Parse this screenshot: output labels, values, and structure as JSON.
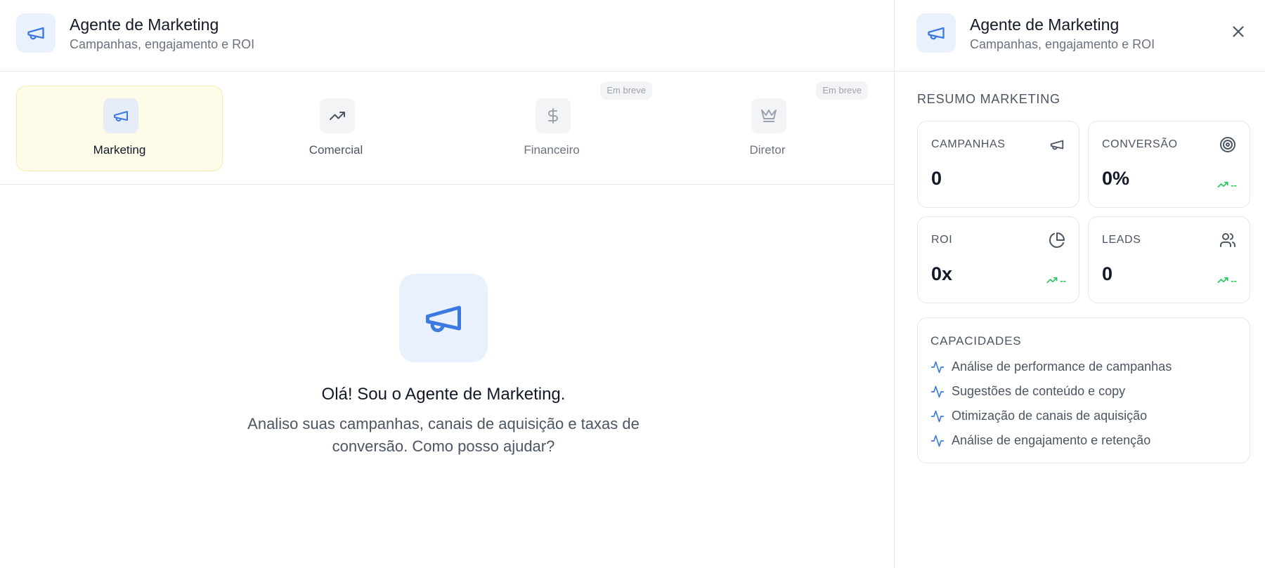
{
  "main_header": {
    "title": "Agente de Marketing",
    "subtitle": "Campanhas, engajamento e ROI",
    "icon": "megaphone-icon"
  },
  "agents": [
    {
      "label": "Marketing",
      "icon": "megaphone-icon",
      "active": true,
      "badge": ""
    },
    {
      "label": "Comercial",
      "icon": "trending-up-icon",
      "active": false,
      "badge": ""
    },
    {
      "label": "Financeiro",
      "icon": "dollar-sign-icon",
      "active": false,
      "badge": "Em breve"
    },
    {
      "label": "Diretor",
      "icon": "crown-icon",
      "active": false,
      "badge": "Em breve"
    }
  ],
  "welcome": {
    "title": "Olá! Sou o Agente de Marketing.",
    "text": "Analiso suas campanhas, canais de aquisição e taxas de conversão. Como posso ajudar?"
  },
  "side_header": {
    "title": "Agente de Marketing",
    "subtitle": "Campanhas, engajamento e ROI"
  },
  "summary": {
    "title": "Resumo Marketing",
    "cards": [
      {
        "label": "Campanhas",
        "value": "0",
        "icon": "megaphone-icon",
        "trend": ""
      },
      {
        "label": "Conversão",
        "value": "0%",
        "icon": "target-icon",
        "trend": "--"
      },
      {
        "label": "ROI",
        "value": "0x",
        "icon": "pie-chart-icon",
        "trend": "--"
      },
      {
        "label": "Leads",
        "value": "0",
        "icon": "users-icon",
        "trend": "--"
      }
    ]
  },
  "capabilities": {
    "title": "Capacidades",
    "items": [
      "Análise de performance de campanhas",
      "Sugestões de conteúdo e copy",
      "Otimização de canais de aquisição",
      "Análise de engajamento e retenção"
    ]
  },
  "colors": {
    "accent_blue": "#3b7ae0",
    "active_tab_bg": "#fefbe8",
    "trend_green": "#22c55e"
  }
}
